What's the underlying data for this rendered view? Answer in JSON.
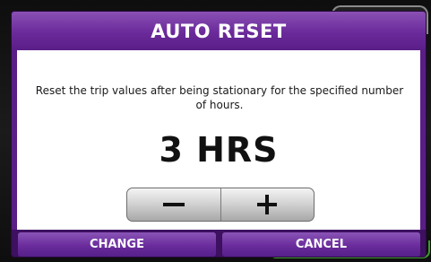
{
  "dialog": {
    "title": "AUTO RESET",
    "description": "Reset the trip values after being stationary for the specified number of hours.",
    "value": "3 HRS"
  },
  "stepper": {
    "decrease_icon": "minus-icon",
    "increase_icon": "plus-icon"
  },
  "buttons": {
    "change_label": "CHANGE",
    "cancel_label": "CANCEL"
  },
  "colors": {
    "accent": "#6a2a9a",
    "title_text": "#ffffff",
    "content_bg": "#ffffff"
  }
}
